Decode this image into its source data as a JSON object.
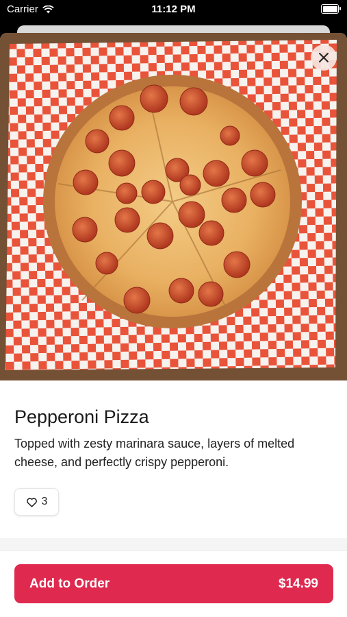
{
  "status_bar": {
    "carrier": "Carrier",
    "time": "11:12 PM",
    "battery_level": 1.0
  },
  "item": {
    "name": "Pepperoni Pizza",
    "description": "Topped with zesty marinara sauce, layers of melted cheese, and perfectly crispy pepperoni.",
    "likes": "3"
  },
  "order": {
    "label": "Add to Order",
    "price": "$14.99"
  },
  "colors": {
    "accent": "#e0294f",
    "close_bg": "#f5e6e1"
  },
  "icons": {
    "close": "close-icon",
    "like": "heart-outline-icon",
    "wifi": "wifi-icon",
    "battery": "battery-icon"
  }
}
